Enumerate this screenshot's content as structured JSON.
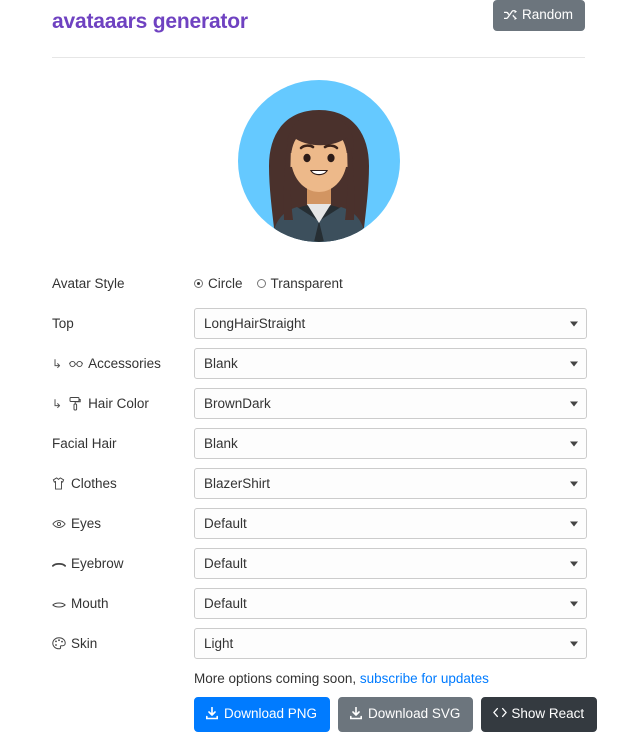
{
  "header": {
    "title": "avataaars generator",
    "random_button": "Random",
    "random_icon": "shuffle-icon"
  },
  "avatar": {
    "style": "Circle",
    "background_color": "#65c9ff",
    "skin_color": "#edb98a",
    "hair_color": "#4a312c",
    "clothes_color": "#262e33",
    "clothes_accent": "#3c4f5c"
  },
  "form": {
    "avatar_style": {
      "label": "Avatar Style",
      "options": [
        "Circle",
        "Transparent"
      ],
      "selected": "Circle"
    },
    "fields": [
      {
        "label": "Top",
        "icon": "",
        "sub": false,
        "value": "LongHairStraight"
      },
      {
        "label": "Accessories",
        "icon": "glasses-icon",
        "sub": true,
        "value": "Blank"
      },
      {
        "label": "Hair Color",
        "icon": "paint-roller-icon",
        "sub": true,
        "value": "BrownDark"
      },
      {
        "label": "Facial Hair",
        "icon": "",
        "sub": false,
        "value": "Blank"
      },
      {
        "label": "Clothes",
        "icon": "tshirt-icon",
        "sub": false,
        "value": "BlazerShirt"
      },
      {
        "label": "Eyes",
        "icon": "eye-icon",
        "sub": false,
        "value": "Default"
      },
      {
        "label": "Eyebrow",
        "icon": "eyebrow-icon",
        "sub": false,
        "value": "Default"
      },
      {
        "label": "Mouth",
        "icon": "mouth-icon",
        "sub": false,
        "value": "Default"
      },
      {
        "label": "Skin",
        "icon": "palette-icon",
        "sub": false,
        "value": "Light"
      }
    ]
  },
  "footer": {
    "more_options_text": "More options coming soon,",
    "subscribe_link": "subscribe for updates",
    "buttons": [
      {
        "label": "Download PNG",
        "icon": "download-icon",
        "style": "primary"
      },
      {
        "label": "Download SVG",
        "icon": "download-icon",
        "style": "secondary"
      },
      {
        "label": "Show React",
        "icon": "code-icon",
        "style": "dark"
      }
    ]
  }
}
